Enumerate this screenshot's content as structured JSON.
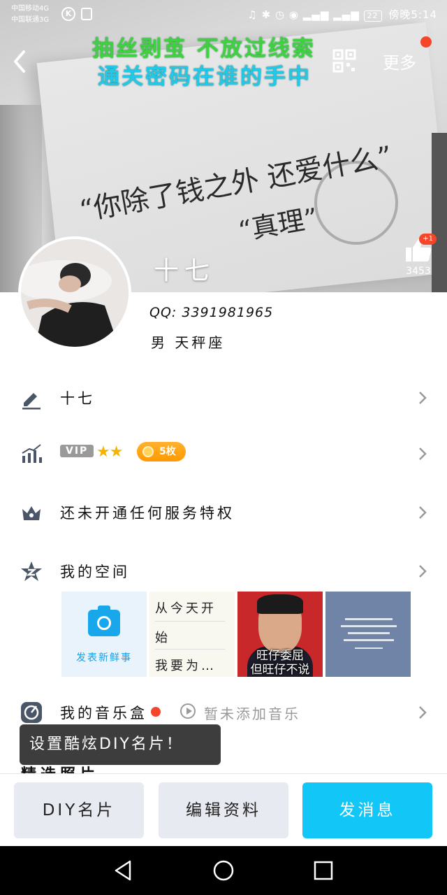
{
  "status_bar": {
    "carrier1": "中国移动4G",
    "carrier2": "中国联通3G",
    "battery": "22",
    "time_label": "傍晚5:14"
  },
  "header": {
    "banner_line1": "抽丝剥茧 不放过线索",
    "banner_line2": "通关密码在谁的手中",
    "more_label": "更多",
    "cover_quote1": "“你除了钱之外 还爱什么”",
    "cover_quote2": "“真理”",
    "likes_plus": "+1",
    "likes_count": "3453"
  },
  "profile": {
    "nickname": "十七",
    "qq": "QQ: 3391981965",
    "gender_sign": "男  天秤座"
  },
  "rows": {
    "signature": "十七",
    "vip_tag": "VIP",
    "stars": "★★",
    "coin_label": "5枚",
    "service": "还未开通任何服务特权",
    "zone": "我的空间",
    "music": "我的音乐盒",
    "music_empty": "暂未添加音乐",
    "partial_row": "精选照片"
  },
  "gallery": {
    "post_label": "发表新鲜事",
    "text_post_lines": [
      "从今天开",
      "始",
      "我要为…"
    ],
    "meme_caption_line1": "旺仔委屈",
    "meme_caption_line2": "但旺仔不说"
  },
  "tooltip": "设置酷炫DIY名片！",
  "bottom_buttons": {
    "diy": "DIY名片",
    "edit": "编辑资料",
    "send": "发消息"
  },
  "colors": {
    "accent": "#12c7f7",
    "badge_red": "#f5452b",
    "coin_orange": "#ff9a00"
  }
}
